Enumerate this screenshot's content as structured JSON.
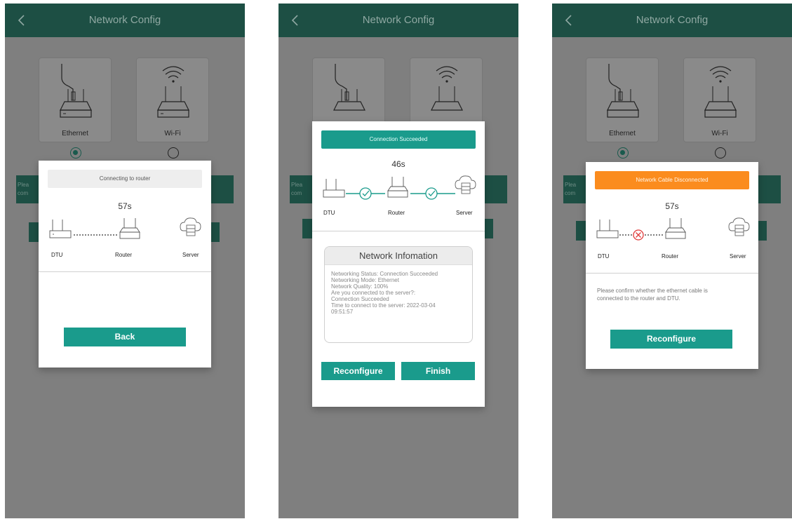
{
  "app": {
    "title": "Network Config"
  },
  "colors": {
    "appbar": "#1d4f44",
    "accent": "#1a9b8c",
    "warning": "#fb8c1e",
    "error": "#e03a3a",
    "overlay": "#7f7f7f"
  },
  "background_screen": {
    "options": [
      {
        "label": "Ethernet",
        "icon": "ethernet-router-icon"
      },
      {
        "label": "Wi-Fi",
        "icon": "wifi-router-icon"
      }
    ],
    "hint_prefix_1": "Plea",
    "hint_prefix_2": "com"
  },
  "devices": {
    "dtu": "DTU",
    "router": "Router",
    "server": "Server"
  },
  "screen1": {
    "status_banner": "Connecting to router",
    "timer": "57s",
    "back_button": "Back",
    "selected_option": "Ethernet"
  },
  "screen2": {
    "status_banner": "Connection Succeeded",
    "timer": "46s",
    "info": {
      "heading": "Network Infomation",
      "lines": [
        "Networking Status: Connection Succeeded",
        "Networking Mode: Ethernet",
        "Network Quality: 100%",
        "Are you connected to the server?:",
        "Connection Succeeded",
        "Time to connect to the server: 2022-03-04",
        "09:51:57"
      ]
    },
    "reconfigure_button": "Reconfigure",
    "finish_button": "Finish"
  },
  "screen3": {
    "status_banner": "Network Cable Disconnected",
    "timer": "57s",
    "message_lines": [
      "Please confirm whether the ethernet cable is",
      "connected to the router and DTU."
    ],
    "reconfigure_button": "Reconfigure",
    "selected_option": "Ethernet"
  }
}
